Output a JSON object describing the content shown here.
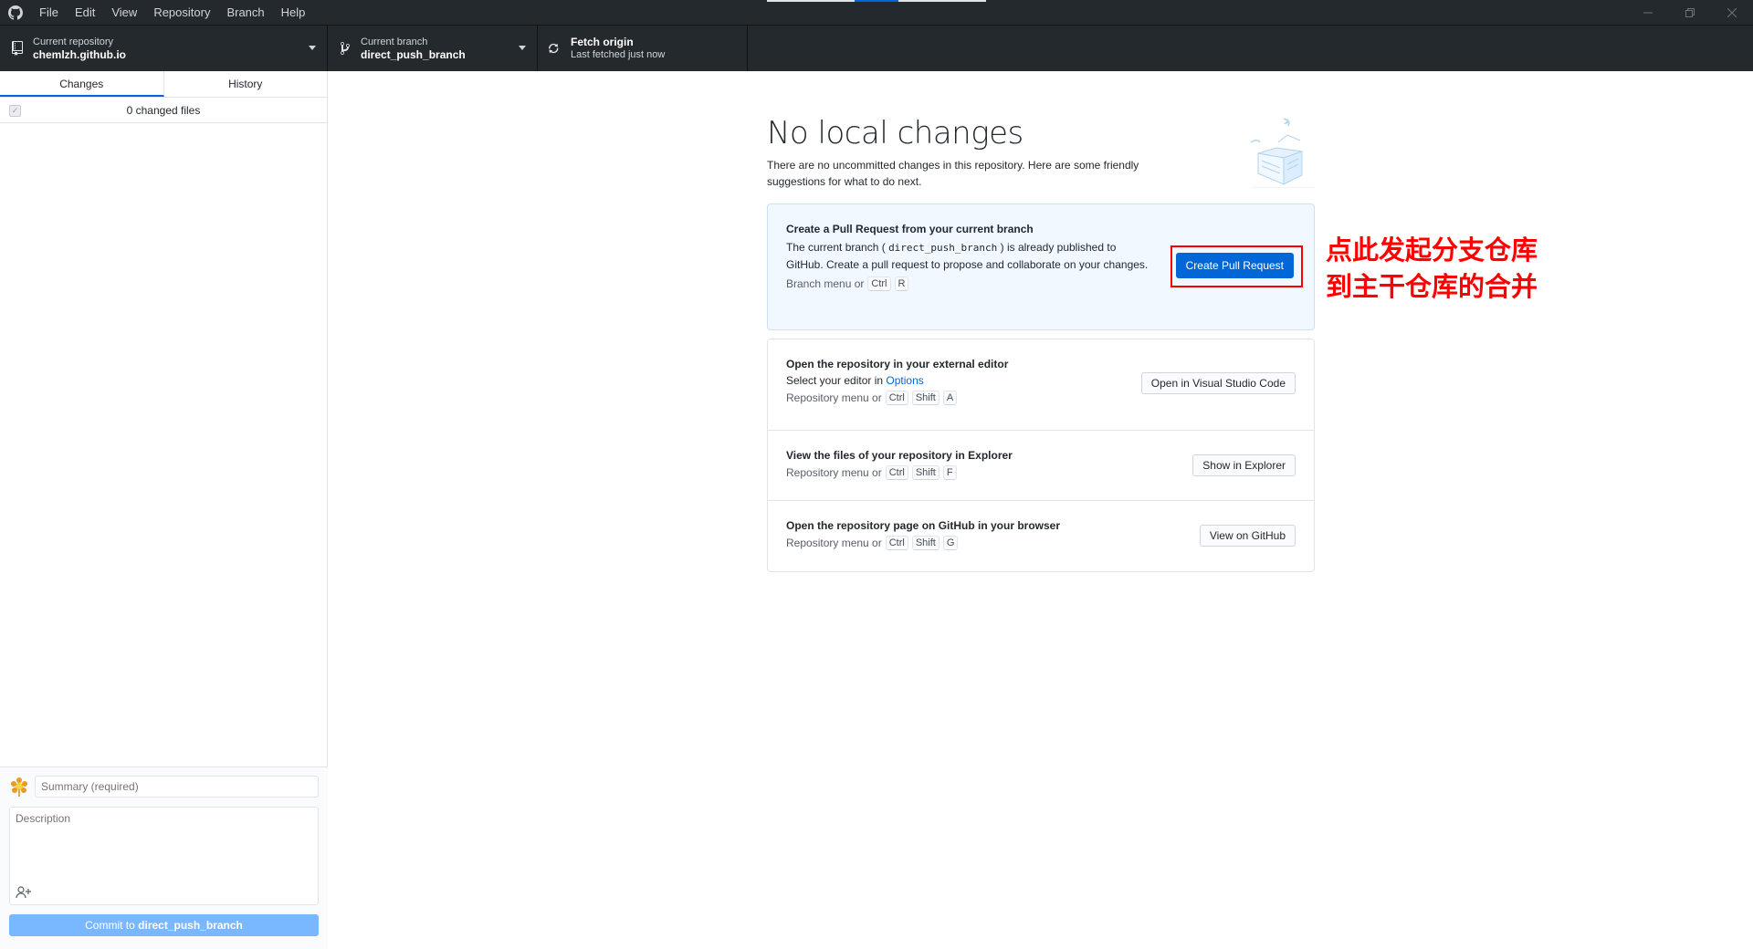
{
  "menu": [
    "File",
    "Edit",
    "View",
    "Repository",
    "Branch",
    "Help"
  ],
  "toolbar": {
    "repo_label": "Current repository",
    "repo_value": "chemlzh.github.io",
    "branch_label": "Current branch",
    "branch_value": "direct_push_branch",
    "fetch_label": "Fetch origin",
    "fetch_sub": "Last fetched just now"
  },
  "sidebar": {
    "tabs": [
      "Changes",
      "History"
    ],
    "changed_files": "0 changed files",
    "summary_placeholder": "Summary (required)",
    "description_placeholder": "Description",
    "commit_prefix": "Commit to",
    "commit_branch": "direct_push_branch"
  },
  "main": {
    "title": "No local changes",
    "subtitle": "There are no uncommitted changes in this repository. Here are some friendly suggestions for what to do next.",
    "pr_card": {
      "title": "Create a Pull Request from your current branch",
      "body_1": "The current branch (",
      "branch": "direct_push_branch",
      "body_2": ") is already published to GitHub. Create a pull request to propose and collaborate on your changes.",
      "shortcut_prefix": "Branch menu or",
      "keys": [
        "Ctrl",
        "R"
      ],
      "button": "Create Pull Request"
    },
    "editor": {
      "title": "Open the repository in your external editor",
      "body": "Select your editor in",
      "link": "Options",
      "shortcut_prefix": "Repository menu or",
      "keys": [
        "Ctrl",
        "Shift",
        "A"
      ],
      "button": "Open in Visual Studio Code"
    },
    "explorer": {
      "title": "View the files of your repository in Explorer",
      "shortcut_prefix": "Repository menu or",
      "keys": [
        "Ctrl",
        "Shift",
        "F"
      ],
      "button": "Show in Explorer"
    },
    "github": {
      "title": "Open the repository page on GitHub in your browser",
      "shortcut_prefix": "Repository menu or",
      "keys": [
        "Ctrl",
        "Shift",
        "G"
      ],
      "button": "View on GitHub"
    }
  },
  "annotation": {
    "line1": "点此发起分支仓库",
    "line2": "到主干仓库的合并"
  },
  "colors": {
    "titlebar": "#24292e",
    "primary": "#0366d6",
    "annotation": "#ff0000"
  }
}
